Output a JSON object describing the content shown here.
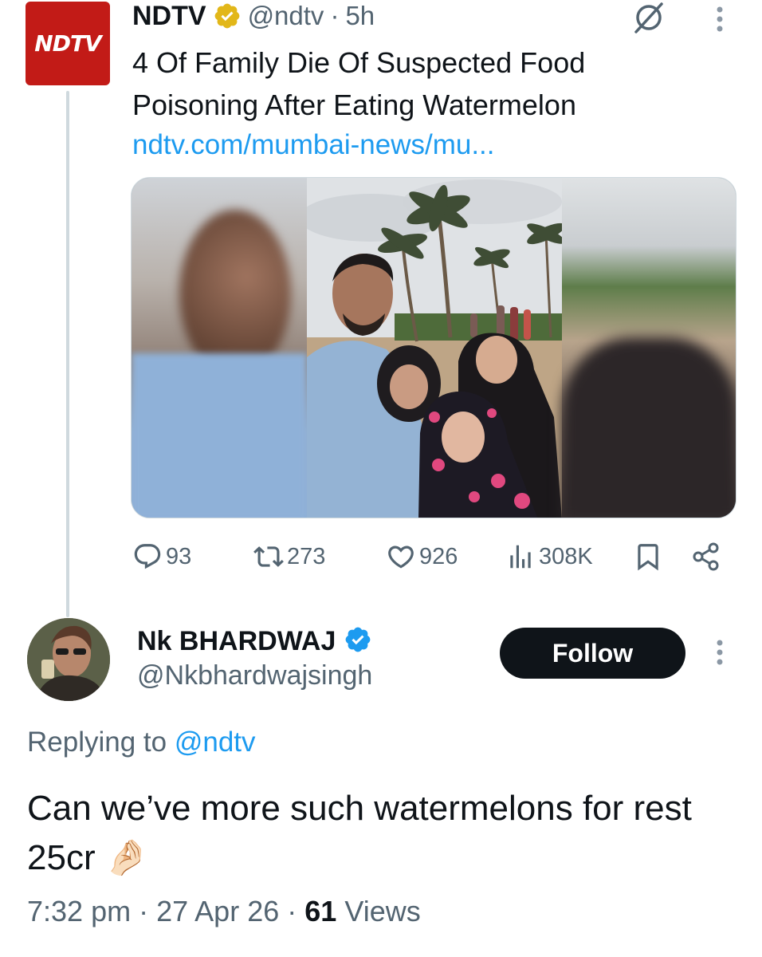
{
  "parent_tweet": {
    "avatar_text": "NDTV",
    "author_name": "NDTV",
    "handle": "@ndtv",
    "separator": "·",
    "time": "5h",
    "text": "4 Of Family Die Of Suspected Food Poisoning After Eating Watermelon",
    "link": "ndtv.com/mumbai-news/mu...",
    "badge": "gold-verified-badge-icon",
    "stats": {
      "replies": "93",
      "reposts": "273",
      "likes": "926",
      "views": "308K"
    }
  },
  "reply": {
    "author_name": "Nk BHARDWAJ",
    "handle": "@Nkbhardwajsingh",
    "follow_label": "Follow",
    "replying_prefix": "Replying to",
    "replying_mention": "@ndtv",
    "text": "Can we’ve more such watermelons for rest 25cr",
    "emoji": "🤌🏻",
    "time": "7:32 pm",
    "date": "27 Apr 26",
    "views_count": "61",
    "views_label": "Views"
  },
  "colors": {
    "accent": "#1d9bf0",
    "gold_badge": "#e2b719",
    "text_primary": "#0f1419",
    "text_secondary": "#536471",
    "ndtv_red": "#c21b17"
  }
}
